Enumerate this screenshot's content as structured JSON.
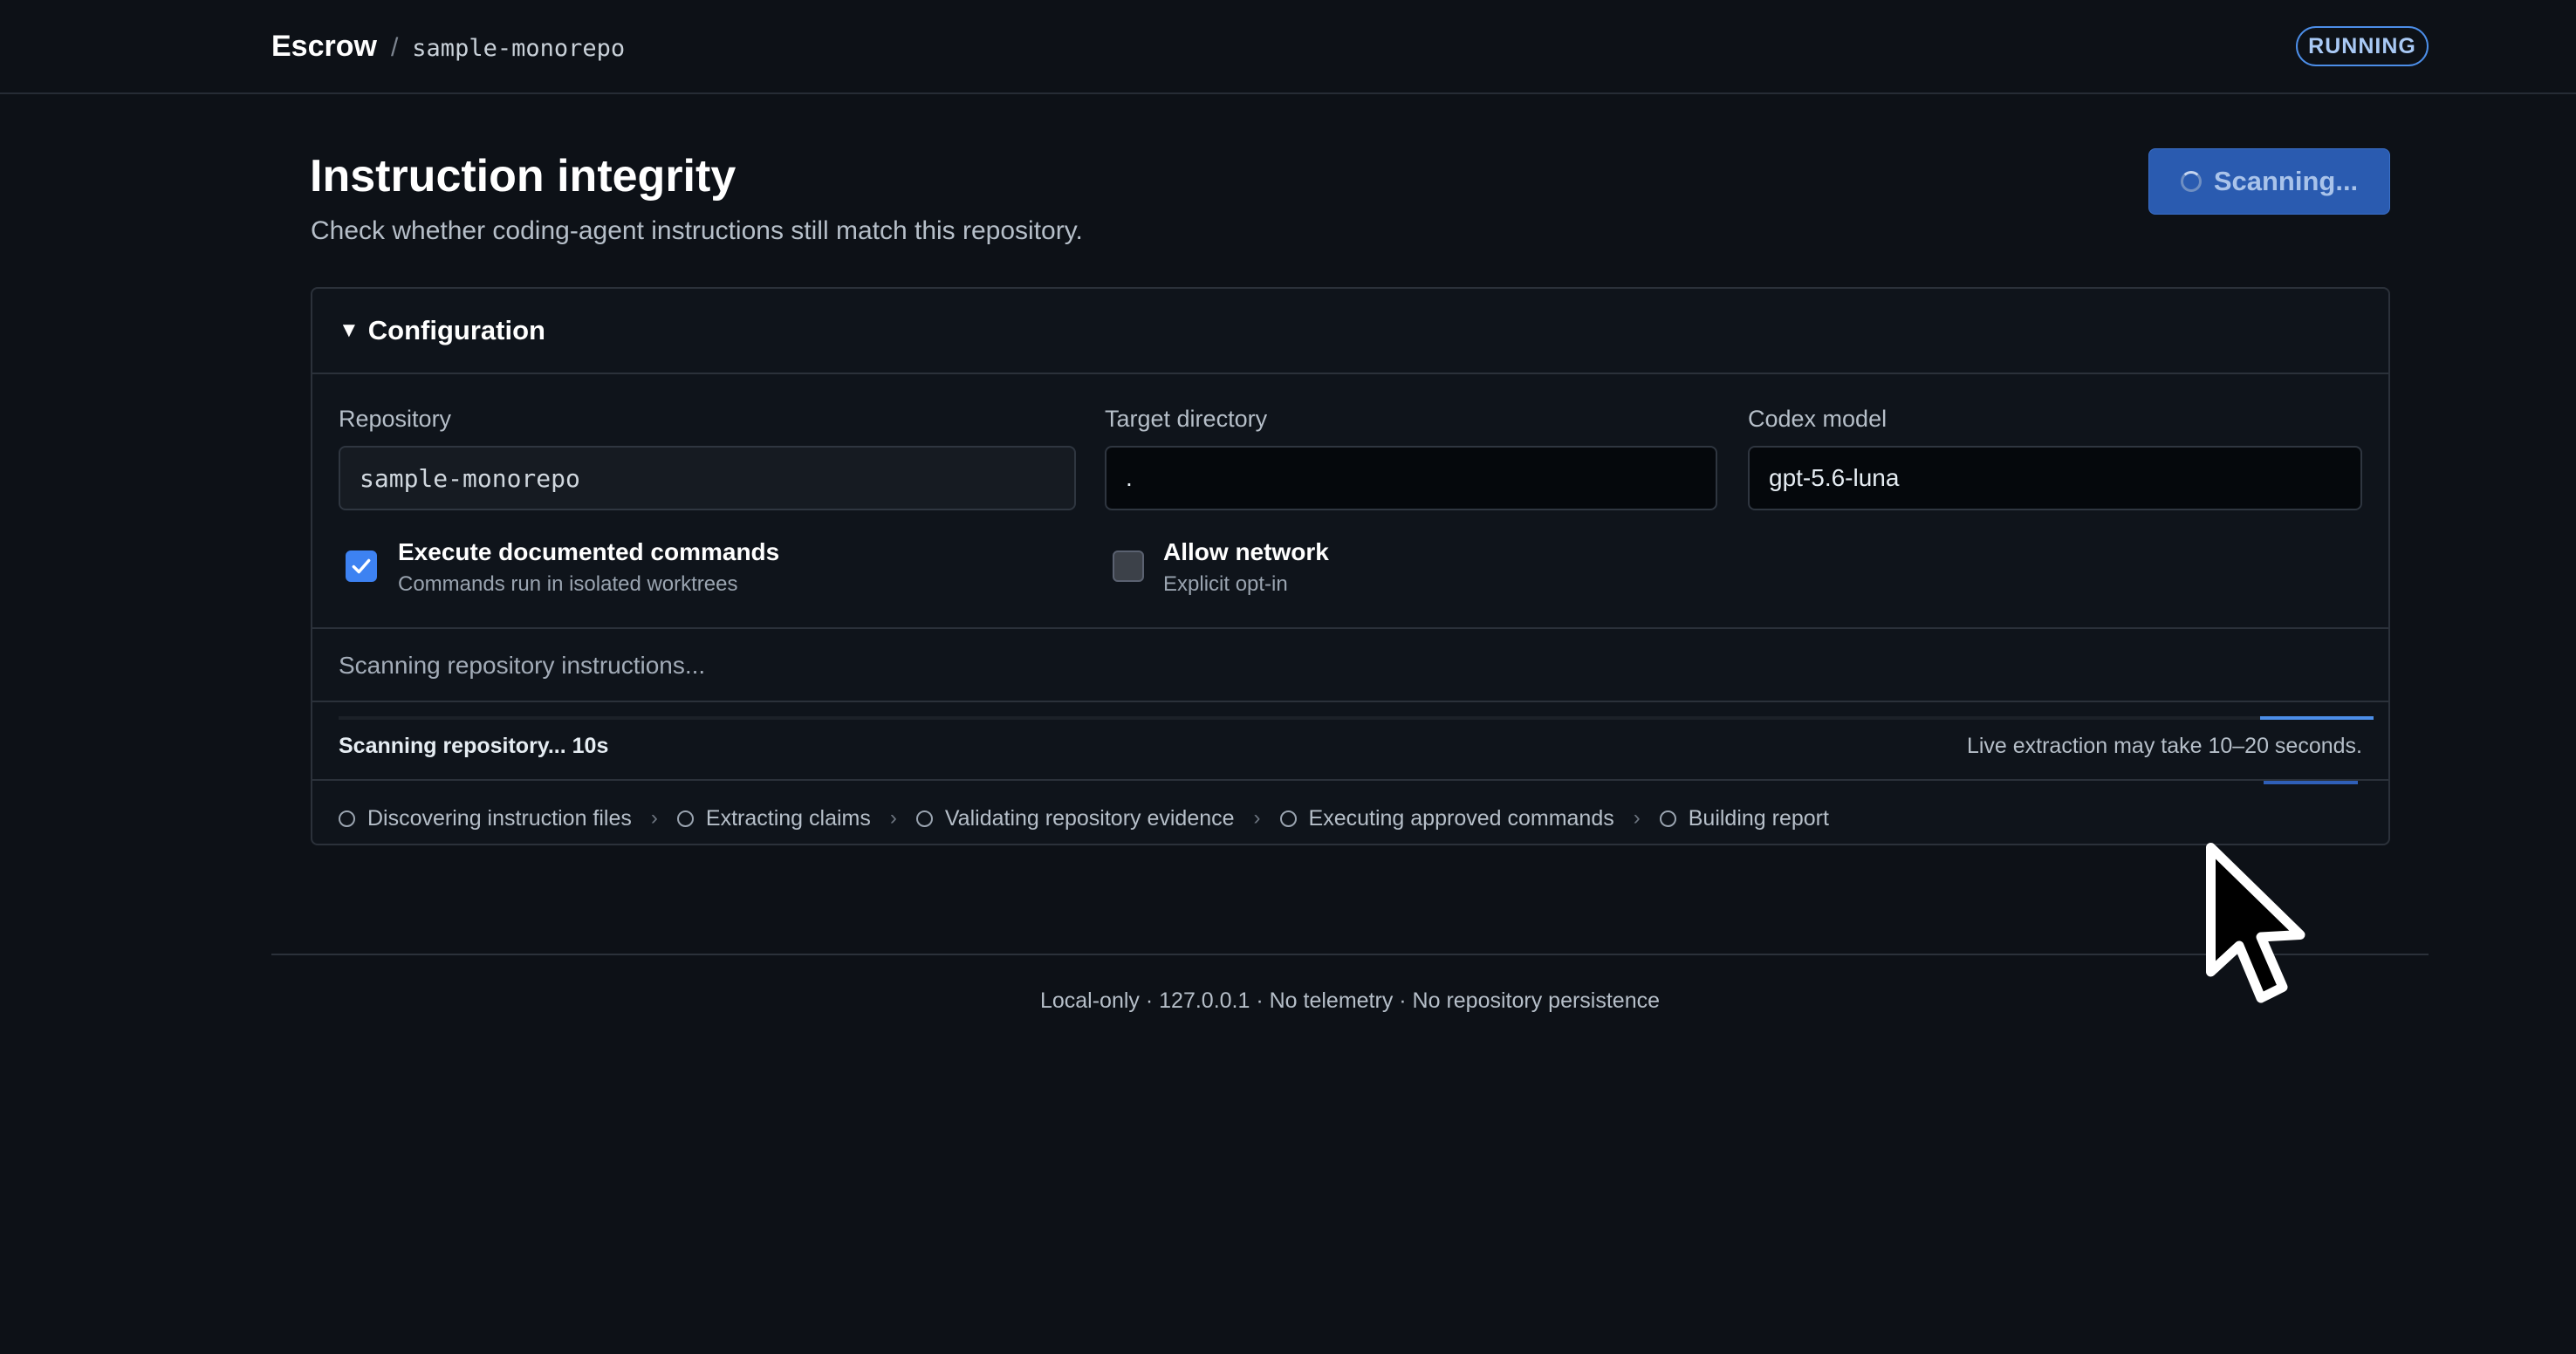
{
  "header": {
    "app_name": "Escrow",
    "separator": "/",
    "repo": "sample-monorepo",
    "status_badge": "RUNNING"
  },
  "page": {
    "title": "Instruction integrity",
    "subtitle": "Check whether coding-agent instructions still match this repository.",
    "scan_button_label": "Scanning..."
  },
  "configuration": {
    "section_label": "Configuration",
    "repository": {
      "label": "Repository",
      "value": "sample-monorepo"
    },
    "target_directory": {
      "label": "Target directory",
      "value": "."
    },
    "codex_model": {
      "label": "Codex model",
      "value": "gpt-5.6-luna"
    },
    "execute_commands": {
      "checked": true,
      "title": "Execute documented commands",
      "subtitle": "Commands run in isolated worktrees"
    },
    "allow_network": {
      "checked": false,
      "title": "Allow network",
      "subtitle": "Explicit opt-in"
    }
  },
  "progress": {
    "status_message": "Scanning repository instructions...",
    "elapsed_label": "Scanning repository... 10s",
    "eta_note": "Live extraction may take 10–20 seconds.",
    "steps": [
      "Discovering instruction files",
      "Extracting claims",
      "Validating repository evidence",
      "Executing approved commands",
      "Building report"
    ]
  },
  "footer": {
    "text": "Local-only · 127.0.0.1 · No telemetry · No repository persistence"
  },
  "colors": {
    "background": "#0d1117",
    "accent": "#4c8ee8",
    "button": "#2a5bb0",
    "checkbox_on": "#3d82f2"
  },
  "icons": {
    "caret": "caret-down-icon",
    "spinner": "spinner-icon",
    "checkmark": "checkmark-icon",
    "step": "circle-icon",
    "step_separator": "chevron-right-icon",
    "cursor": "mouse-pointer-icon"
  }
}
